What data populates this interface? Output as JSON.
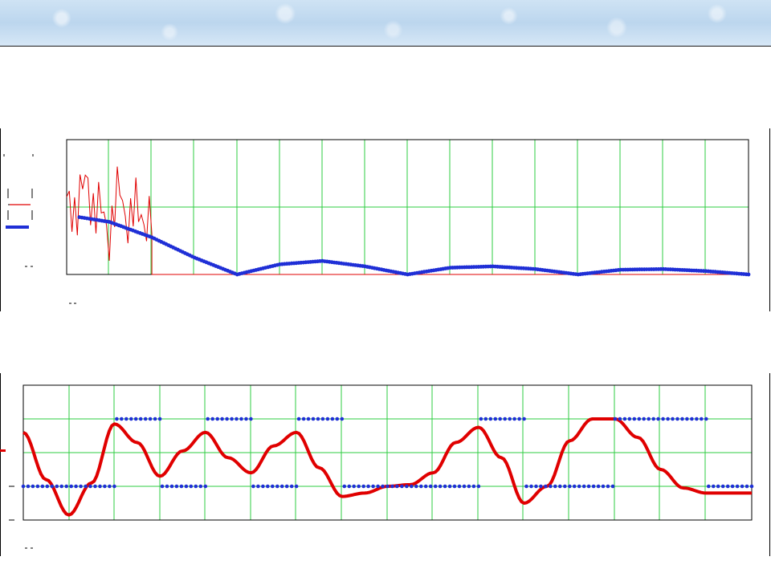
{
  "chart_data": [
    {
      "type": "line",
      "title": "",
      "xlabel": "",
      "ylabel": "",
      "grid": true,
      "grid_color": "#2ecc40",
      "xlim": [
        0,
        16
      ],
      "ylim": [
        0,
        2
      ],
      "series": [
        {
          "color": "#e00000",
          "style": "thin-noisy-line",
          "x": [
            0.0,
            0.25,
            0.5,
            0.75,
            1.0,
            1.25,
            1.5,
            1.75,
            2.0,
            2.0,
            16.0
          ],
          "y": [
            0.9,
            1.1,
            1.3,
            0.9,
            0.7,
            1.2,
            0.8,
            1.0,
            0.6,
            0.0,
            0.0
          ]
        },
        {
          "color": "#1f2fd6",
          "style": "dotted-thick",
          "x": [
            0.3,
            1.0,
            2.0,
            3.0,
            4.0,
            5.0,
            6.0,
            7.0,
            8.0,
            9.0,
            10.0,
            11.0,
            12.0,
            13.0,
            14.0,
            15.0,
            16.0
          ],
          "y": [
            0.85,
            0.78,
            0.55,
            0.25,
            0.0,
            0.15,
            0.2,
            0.12,
            0.0,
            0.1,
            0.12,
            0.08,
            0.0,
            0.07,
            0.08,
            0.05,
            0.0
          ]
        }
      ]
    },
    {
      "type": "line",
      "title": "",
      "xlabel": "",
      "ylabel": "",
      "grid": true,
      "grid_color": "#2ecc40",
      "xlim": [
        0,
        16
      ],
      "ylim": [
        -1,
        3
      ],
      "series": [
        {
          "color": "#e00000",
          "style": "thick-line",
          "x": [
            0.0,
            0.5,
            1.0,
            1.5,
            2.0,
            2.5,
            3.0,
            3.5,
            4.0,
            4.5,
            5.0,
            5.5,
            6.0,
            6.5,
            7.0,
            7.5,
            8.0,
            8.5,
            9.0,
            9.5,
            10.0,
            10.5,
            11.0,
            11.5,
            12.0,
            12.5,
            13.0,
            13.5,
            14.0,
            14.5,
            15.0,
            15.5,
            16.0
          ],
          "y": [
            1.6,
            0.2,
            -0.85,
            0.1,
            1.85,
            1.3,
            0.3,
            1.05,
            1.6,
            0.85,
            0.4,
            1.2,
            1.6,
            0.55,
            -0.3,
            -0.2,
            0.0,
            0.05,
            0.4,
            1.3,
            1.75,
            0.85,
            -0.5,
            0.0,
            1.35,
            2.0,
            2.0,
            1.45,
            0.5,
            -0.05,
            -0.2,
            -0.2,
            -0.2
          ]
        },
        {
          "color": "#1f2fd6",
          "style": "dotted-square-wave",
          "x": [
            0.0,
            2.0,
            2.0,
            3.0,
            3.0,
            4.0,
            4.0,
            5.0,
            5.0,
            6.0,
            6.0,
            7.0,
            7.0,
            10.0,
            10.0,
            11.0,
            11.0,
            13.0,
            13.0,
            15.0,
            15.0,
            16.0
          ],
          "y": [
            0,
            0,
            2,
            2,
            0,
            0,
            2,
            2,
            0,
            0,
            2,
            2,
            0,
            0,
            2,
            2,
            0,
            0,
            2,
            2,
            0,
            0
          ]
        }
      ]
    }
  ]
}
